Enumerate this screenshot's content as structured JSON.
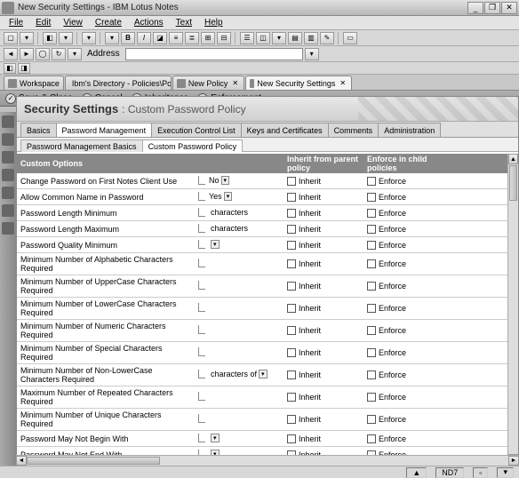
{
  "window": {
    "title": "New Security Settings - IBM Lotus Notes"
  },
  "menus": [
    "File",
    "Edit",
    "View",
    "Create",
    "Actions",
    "Text",
    "Help"
  ],
  "address_label": "Address",
  "workspace_tabs": [
    {
      "label": "Workspace",
      "closable": false
    },
    {
      "label": "Ibm's Directory - Policies\\Polici…",
      "closable": true
    },
    {
      "label": "New Policy",
      "closable": true
    },
    {
      "label": "New Security Settings",
      "closable": true,
      "active": true
    }
  ],
  "actions": [
    {
      "label": "Save & Close",
      "icon": "✓"
    },
    {
      "label": "Cancel",
      "icon": "✕"
    },
    {
      "label": "Inheritance",
      "icon": "◎"
    },
    {
      "label": "Enforcement",
      "icon": "◎"
    }
  ],
  "banner": {
    "title": "Security Settings",
    "sub": ": Custom Password Policy"
  },
  "main_tabs": [
    "Basics",
    "Password Management",
    "Execution Control List",
    "Keys and Certificates",
    "Comments",
    "Administration"
  ],
  "main_tab_active": 1,
  "sub_tabs": [
    "Password Management Basics",
    "Custom Password Policy"
  ],
  "sub_tab_active": 1,
  "columns": {
    "options": "Custom Options",
    "inherit": "Inherit from parent policy",
    "enforce": "Enforce in child policies",
    "inherit_label": "Inherit",
    "enforce_label": "Enforce"
  },
  "rows": [
    {
      "label": "Change Password on First Notes Client Use",
      "value": "No",
      "dropdown": true
    },
    {
      "label": "Allow Common Name in Password",
      "value": "Yes",
      "dropdown": true
    },
    {
      "label": "Password Length Minimum",
      "value": "",
      "suffix": "characters"
    },
    {
      "label": "Password Length Maximum",
      "value": "",
      "suffix": "characters"
    },
    {
      "label": "Password Quality Minimum",
      "value": "",
      "dropdown": true
    },
    {
      "label": "Minimum Number of Alphabetic Characters Required",
      "value": ""
    },
    {
      "label": "Minimum Number of UpperCase Characters Required",
      "value": ""
    },
    {
      "label": "Minimum Number of LowerCase Characters Required",
      "value": ""
    },
    {
      "label": "Minimum Number of Numeric Characters Required",
      "value": ""
    },
    {
      "label": "Minimum Number of Special Characters Required",
      "value": ""
    },
    {
      "label": "Minimum Number of Non-LowerCase Characters Required",
      "value": "",
      "suffix": "characters of",
      "dropdown": true
    },
    {
      "label": "Maximum Number of Repeated Characters Required",
      "value": ""
    },
    {
      "label": "Minimum Number of Unique Characters Required",
      "value": ""
    },
    {
      "label": "Password May Not Begin With",
      "value": "",
      "dropdown": true
    },
    {
      "label": "Password May Not End With",
      "value": "",
      "dropdown": true
    }
  ],
  "status": {
    "right": "ND7"
  }
}
